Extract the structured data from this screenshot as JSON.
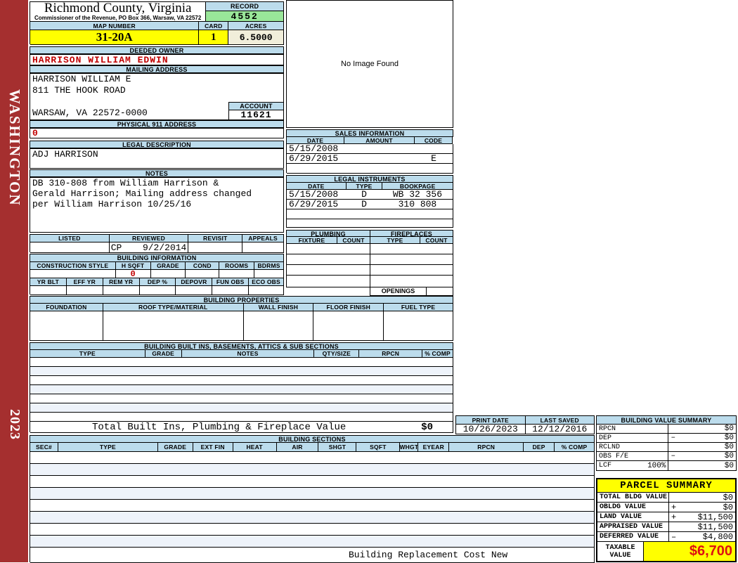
{
  "sidebar": {
    "district": "WASHINGTON",
    "year": "2023"
  },
  "header": {
    "title": "Richmond County, Virginia",
    "subtitle": "Commissioner of the Revenue, PO Box 366, Warsaw, VA 22572",
    "record_label": "RECORD",
    "record_value": "4552",
    "map_number_label": "MAP NUMBER",
    "map_number": "31-20A",
    "card_label": "CARD",
    "card": "1",
    "acres_label": "ACRES",
    "acres": "6.5000"
  },
  "owner": {
    "deeded_owner_label": "DEEDED OWNER",
    "deeded_owner": "HARRISON WILLIAM EDWIN",
    "mailing_label": "MAILING ADDRESS",
    "mailing_lines": [
      "HARRISON WILLIAM E",
      "811 THE HOOK ROAD",
      "",
      "WARSAW, VA 22572-0000"
    ],
    "account_label": "ACCOUNT",
    "account": "11621",
    "physical_label": "PHYSICAL 911 ADDRESS",
    "physical_address": "0",
    "legal_label": "LEGAL DESCRIPTION",
    "legal_description": "ADJ HARRISON",
    "notes_label": "NOTES",
    "notes_lines": [
      "DB 310-808 from William Harrison &",
      "Gerald Harrison; Mailing address changed",
      "per William Harrison 10/25/16"
    ]
  },
  "review": {
    "headers": [
      "LISTED",
      "REVIEWED",
      "REVISIT",
      "APPEALS"
    ],
    "reviewed_by": "CP",
    "reviewed_date": "9/2/2014"
  },
  "building_information": {
    "title": "BUILDING INFORMATION",
    "row1_headers": [
      "CONSTRUCTION STYLE",
      "H SQFT",
      "GRADE",
      "COND",
      "ROOMS",
      "BDRMS"
    ],
    "h_sqft": "0",
    "row2_headers": [
      "YR BLT",
      "EFF YR",
      "REM YR",
      "DEP %",
      "DEPOVR",
      "FUN OBS",
      "ECO OBS"
    ]
  },
  "photo": {
    "placeholder": "No Image Found"
  },
  "sales": {
    "title": "SALES INFORMATION",
    "headers": [
      "DATE",
      "AMOUNT",
      "CODE"
    ],
    "rows": [
      {
        "date": "5/15/2008",
        "amount": "",
        "code": ""
      },
      {
        "date": "6/29/2015",
        "amount": "",
        "code": "E"
      }
    ]
  },
  "instruments": {
    "title": "LEGAL INSTRUMENTS",
    "headers": [
      "DATE",
      "TYPE",
      "BOOKPAGE"
    ],
    "rows": [
      {
        "date": "5/15/2008",
        "type": "D",
        "bookpage": "WB 32 356"
      },
      {
        "date": "6/29/2015",
        "type": "D",
        "bookpage": "310 808"
      }
    ]
  },
  "plumbing": {
    "title": "PLUMBING",
    "headers": [
      "FIXTURE",
      "COUNT"
    ]
  },
  "fireplaces": {
    "title": "FIREPLACES",
    "headers": [
      "TYPE",
      "COUNT"
    ],
    "openings_label": "OPENINGS"
  },
  "building_properties": {
    "title": "BUILDING PROPERTIES",
    "headers": [
      "FOUNDATION",
      "ROOF TYPE/MATERIAL",
      "WALL FINISH",
      "FLOOR FINISH",
      "FUEL TYPE"
    ]
  },
  "built_ins": {
    "title": "BUILDING BUILT INS, BASEMENTS, ATTICS & SUB SECTIONS",
    "headers": [
      "TYPE",
      "GRADE",
      "NOTES",
      "QTY/SIZE",
      "RPCN",
      "% COMP"
    ],
    "total_label": "Total Built Ins, Plumbing & Fireplace Value",
    "total_value": "$0"
  },
  "meta": {
    "print_date_label": "PRINT DATE",
    "print_date": "10/26/2023",
    "last_saved_label": "LAST SAVED",
    "last_saved": "12/12/2016"
  },
  "building_value_summary": {
    "title": "BUILDING VALUE SUMMARY",
    "rows": [
      {
        "label": "RPCN",
        "pct": "",
        "op": "",
        "value": "$0"
      },
      {
        "label": "DEP",
        "pct": "",
        "op": "–",
        "value": "$0"
      },
      {
        "label": "RCLND",
        "pct": "",
        "op": "",
        "value": "$0"
      },
      {
        "label": "OBS F/E",
        "pct": "",
        "op": "–",
        "value": "$0"
      },
      {
        "label": "LCF",
        "pct": "100%",
        "op": "",
        "value": "$0"
      }
    ]
  },
  "building_sections": {
    "title": "BUILDING SECTIONS",
    "headers": [
      "SEC#",
      "TYPE",
      "GRADE",
      "EXT FIN",
      "HEAT",
      "AIR",
      "SHGT",
      "SQFT",
      "WHGT",
      "EYEAR",
      "RPCN",
      "DEP",
      "% COMP"
    ],
    "footer_label": "Building Replacement Cost New"
  },
  "parcel_summary": {
    "title": "PARCEL SUMMARY",
    "rows": [
      {
        "label": "TOTAL BLDG VALUE",
        "op": "",
        "value": "$0"
      },
      {
        "label": "OBLDG VALUE",
        "op": "+",
        "value": "$0"
      },
      {
        "label": "LAND VALUE",
        "op": "+",
        "value": "$11,500"
      },
      {
        "label": "APPRAISED VALUE",
        "op": "",
        "value": "$11,500"
      },
      {
        "label": "DEFERRED VALUE",
        "op": "–",
        "value": "$4,800"
      }
    ],
    "taxable_label": "TAXABLE VALUE",
    "taxable_value": "$6,700"
  },
  "colors": {
    "header_blue": "#bcdcec",
    "record_green": "#99e699",
    "highlight_yellow": "#ffff00",
    "acres_cream": "#f1eeda",
    "accent_red": "#c00000",
    "sidebar_red": "#a52f2f"
  }
}
